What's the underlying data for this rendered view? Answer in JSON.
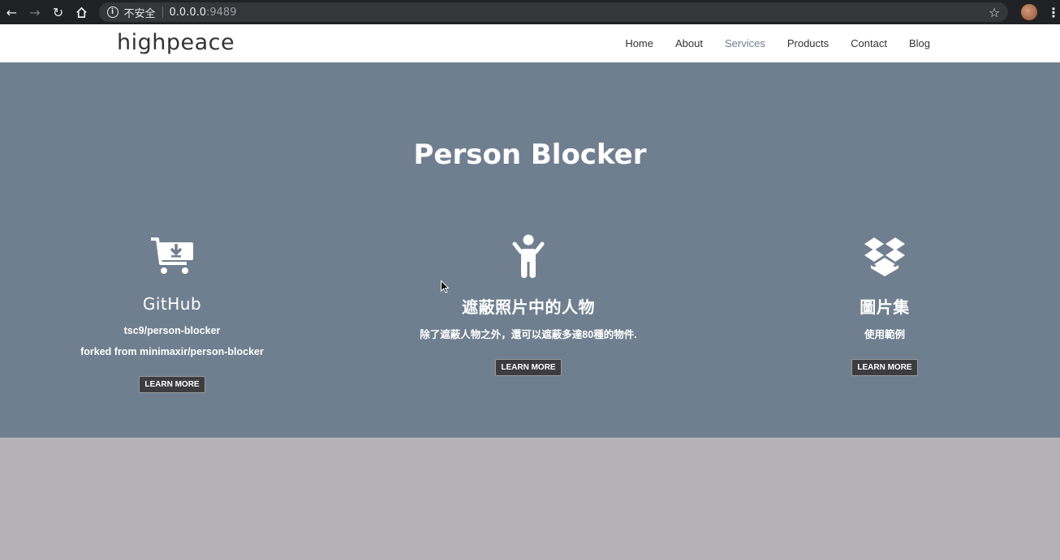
{
  "browser": {
    "security_label": "不安全",
    "host": "0.0.0.0",
    "port": ":9489",
    "icons": [
      "back-icon",
      "forward-icon",
      "reload-icon",
      "home-icon",
      "info-icon",
      "star-icon",
      "avatar",
      "menu-icon"
    ]
  },
  "site": {
    "logo": "highpeace",
    "nav": [
      "Home",
      "About",
      "Services",
      "Products",
      "Contact",
      "Blog"
    ],
    "active_nav": "Services"
  },
  "services": {
    "title": "Person Blocker",
    "items": [
      {
        "icon": "cart-download-icon",
        "title": "GitHub",
        "lines": [
          "tsc9/person-blocker",
          "forked from minimaxir/person-blocker"
        ],
        "button": "LEARN MORE"
      },
      {
        "icon": "person-icon",
        "title": "遮蔽照片中的人物",
        "lines": [
          "除了遮蔽人物之外，還可以遮蔽多達80種的物件."
        ],
        "button": "LEARN MORE"
      },
      {
        "icon": "dropbox-icon",
        "title": "圖片集",
        "lines": [
          "使用範例"
        ],
        "button": "LEARN MORE"
      }
    ]
  },
  "colors": {
    "hero_bg": "#707f8f",
    "footer_bg": "#b4b2b5",
    "button_bg": "#3d3c3f"
  }
}
